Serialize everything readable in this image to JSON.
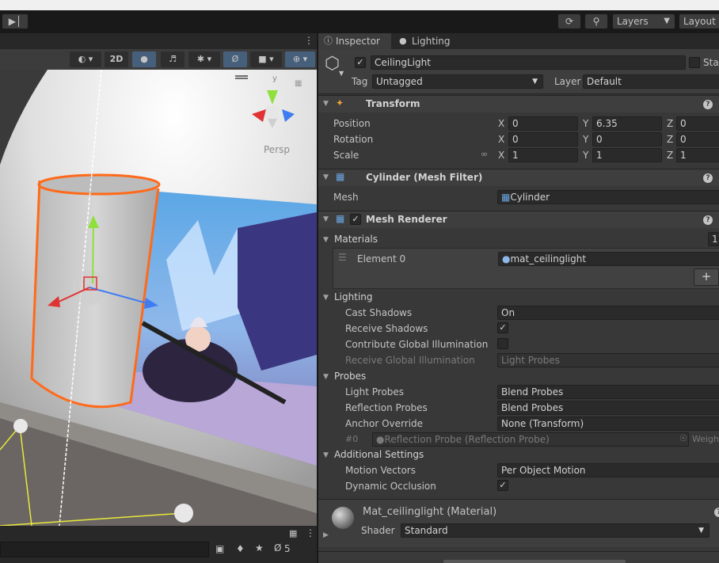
{
  "toolbar": {
    "layers_label": "Layers",
    "layout_label": "Layout"
  },
  "scene": {
    "view_2d_label": "2D",
    "persp_label": "Persp",
    "gizmo_axis_y": "y",
    "footer_hidden_count": "5"
  },
  "inspector": {
    "tab_inspector": "Inspector",
    "tab_lighting": "Lighting",
    "object_name": "CeilingLight",
    "static_label": "Stat",
    "tag_label": "Tag",
    "tag_value": "Untagged",
    "layer_label": "Layer",
    "layer_value": "Default",
    "transform": {
      "title": "Transform",
      "position_label": "Position",
      "rotation_label": "Rotation",
      "scale_label": "Scale",
      "position": {
        "x": "0",
        "y": "6.35",
        "z": "0"
      },
      "rotation": {
        "x": "0",
        "y": "0",
        "z": "0"
      },
      "scale": {
        "x": "1",
        "y": "1",
        "z": "1"
      },
      "axis_x": "X",
      "axis_y": "Y",
      "axis_z": "Z"
    },
    "mesh_filter": {
      "title": "Cylinder (Mesh Filter)",
      "mesh_label": "Mesh",
      "mesh_value": "Cylinder"
    },
    "mesh_renderer": {
      "title": "Mesh Renderer",
      "materials_label": "Materials",
      "materials_count": "1",
      "element0_label": "Element 0",
      "element0_value": "mat_ceilinglight",
      "add_label": "+",
      "lighting_label": "Lighting",
      "cast_shadows_label": "Cast Shadows",
      "cast_shadows_value": "On",
      "receive_shadows_label": "Receive Shadows",
      "contribute_gi_label": "Contribute Global Illumination",
      "receive_gi_label": "Receive Global Illumination",
      "receive_gi_value": "Light Probes",
      "probes_label": "Probes",
      "light_probes_label": "Light Probes",
      "light_probes_value": "Blend Probes",
      "reflection_probes_label": "Reflection Probes",
      "reflection_probes_value": "Blend Probes",
      "anchor_override_label": "Anchor Override",
      "anchor_override_value": "None (Transform)",
      "probe_index": "#0",
      "probe_value": "Reflection Probe (Reflection Probe)",
      "weight_label": "Weight",
      "additional_label": "Additional Settings",
      "motion_vectors_label": "Motion Vectors",
      "motion_vectors_value": "Per Object Motion",
      "dynamic_occlusion_label": "Dynamic Occlusion"
    },
    "material": {
      "name": "Mat_ceilinglight (Material)",
      "shader_label": "Shader",
      "shader_value": "Standard"
    },
    "help_glyph": "?"
  }
}
